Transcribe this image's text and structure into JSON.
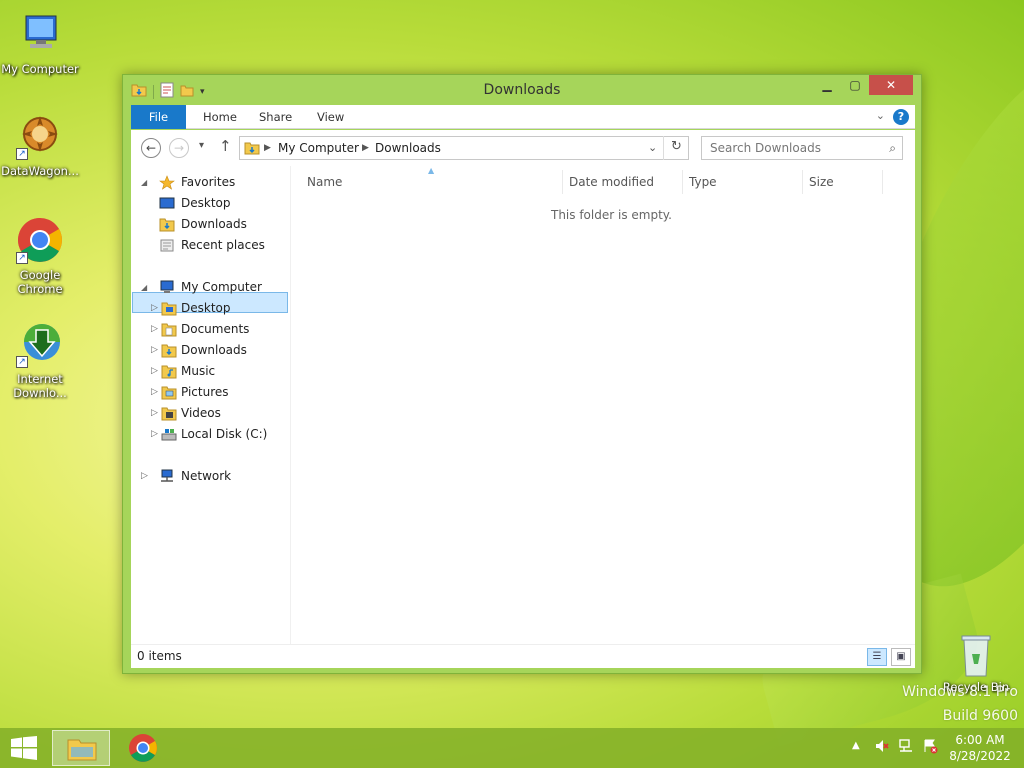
{
  "desktop": {
    "icons": [
      {
        "label": "My Computer"
      },
      {
        "label": "DataWagon..."
      },
      {
        "label": "Google Chrome"
      },
      {
        "label": "Internet Downlo..."
      },
      {
        "label": "Recycle Bin"
      }
    ],
    "watermark_line1": "Windows 8.1 Pro",
    "watermark_line2": "Build 9600"
  },
  "window": {
    "title": "Downloads",
    "ribbon_tabs": [
      "File",
      "Home",
      "Share",
      "View"
    ],
    "help_label": "?",
    "address": {
      "segments": [
        "My Computer",
        "Downloads"
      ]
    },
    "search_placeholder": "Search Downloads",
    "nav": {
      "favorites_label": "Favorites",
      "favorites": [
        "Desktop",
        "Downloads",
        "Recent places"
      ],
      "computer_label": "My Computer",
      "computer_items": [
        "Desktop",
        "Documents",
        "Downloads",
        "Music",
        "Pictures",
        "Videos",
        "Local Disk (C:)"
      ],
      "network_label": "Network",
      "selected": "Downloads"
    },
    "columns": [
      "Name",
      "Date modified",
      "Type",
      "Size"
    ],
    "empty_message": "This folder is empty.",
    "status": "0 items"
  },
  "taskbar": {
    "time": "6:00 AM",
    "date": "8/28/2022",
    "items": [
      "file-explorer",
      "google-chrome"
    ]
  },
  "colors": {
    "accent": "#1979ca",
    "window_frame": "#a6d55a",
    "close_button": "#c7504a",
    "selection": "#cce8ff"
  }
}
